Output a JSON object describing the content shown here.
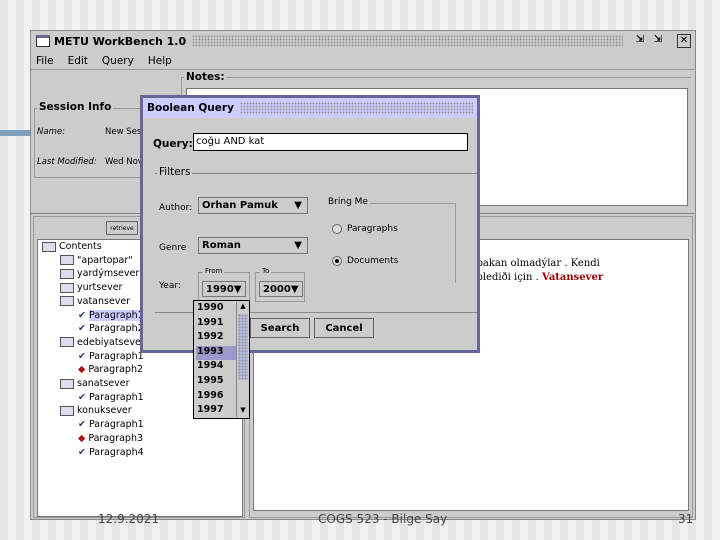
{
  "window": {
    "title": "METU WorkBench 1.0",
    "controls": [
      "minimize",
      "maximize",
      "close"
    ]
  },
  "menu": [
    "File",
    "Edit",
    "Query",
    "Help"
  ],
  "session": {
    "legend": "Session Info",
    "name_label": "Name:",
    "name_value": "New Ses",
    "modified_label": "Last Modified:",
    "modified_value": "Wed Nov"
  },
  "notes": {
    "legend": "Notes:"
  },
  "tree": {
    "button": "retrieve",
    "items": [
      {
        "label": "Contents",
        "type": "folder",
        "level": 0
      },
      {
        "label": "\"apartopar\"",
        "type": "folder",
        "level": 1
      },
      {
        "label": "yardýmsever",
        "type": "folder",
        "level": 1
      },
      {
        "label": "yurtsever",
        "type": "folder",
        "level": 1
      },
      {
        "label": "vatansever",
        "type": "folder",
        "level": 1
      },
      {
        "label": "Paragraph1",
        "type": "check",
        "level": 2,
        "selected": true
      },
      {
        "label": "Paragraph2",
        "type": "check",
        "level": 2
      },
      {
        "label": "edebiyatsever",
        "type": "folder",
        "level": 1
      },
      {
        "label": "Paragraph1",
        "type": "check",
        "level": 2
      },
      {
        "label": "Paragraph2",
        "type": "diamond",
        "level": 2
      },
      {
        "label": "sanatsever",
        "type": "folder",
        "level": 1
      },
      {
        "label": "Paragraph1",
        "type": "check",
        "level": 2
      },
      {
        "label": "konuksever",
        "type": "folder",
        "level": 1
      },
      {
        "label": "Paragraph1",
        "type": "check",
        "level": 2
      },
      {
        "label": "Paragraph3",
        "type": "diamond",
        "level": 2
      },
      {
        "label": "Paragraph4",
        "type": "check",
        "level": 2
      }
    ]
  },
  "document": {
    "line1": "olduklarý için bakan olmadýlar . Kendi",
    "line2": "ler . Kafalarý iþlediði için . ",
    "highlight": "Vatansever",
    "highlight_color": "#990000"
  },
  "dialog": {
    "title": "Boolean Query",
    "query_label": "Query:",
    "query_value": "coğu AND kat",
    "filters_legend": "Filters",
    "author_label": "Author:",
    "author_value": "Orhan Pamuk",
    "genre_label": "Genre",
    "genre_value": "Roman",
    "bring_legend": "Bring Me",
    "radio_paragraphs": "Paragraphs",
    "radio_documents": "Documents",
    "selected_radio": "Documents",
    "year_label": "Year:",
    "from_legend": "From",
    "to_legend": "To",
    "from_value": "1990",
    "to_value": "2000",
    "search": "Search",
    "cancel": "Cancel",
    "year_options": [
      "1990",
      "1991",
      "1992",
      "1993",
      "1994",
      "1995",
      "1996",
      "1997"
    ],
    "highlighted_year": "1993"
  },
  "footer": {
    "date": "12.9.2021",
    "center": "COGS 523 - Bilge Say",
    "page": "31"
  },
  "colors": {
    "dialog_border": "#666699",
    "dialog_title": "#ccccff",
    "selection": "#9999cc"
  }
}
